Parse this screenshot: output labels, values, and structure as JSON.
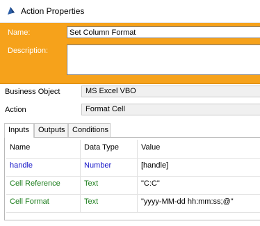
{
  "window": {
    "title": "Action Properties"
  },
  "header": {
    "name_label": "Name:",
    "name_value": "Set Column Format",
    "description_label": "Description:",
    "description_value": ""
  },
  "fields": {
    "business_object_label": "Business Object",
    "business_object_value": "MS Excel VBO",
    "action_label": "Action",
    "action_value": "Format Cell"
  },
  "tabs": [
    {
      "label": "Inputs",
      "active": true
    },
    {
      "label": "Outputs",
      "active": false
    },
    {
      "label": "Conditions",
      "active": false
    }
  ],
  "table": {
    "columns": [
      "Name",
      "Data Type",
      "Value"
    ],
    "rows": [
      {
        "name": "handle",
        "type": "Number",
        "value": "[handle]",
        "color": "#1414c8"
      },
      {
        "name": "Cell Reference",
        "type": "Text",
        "value": "\"C:C\"",
        "color": "#1a7d1a"
      },
      {
        "name": "Cell Format",
        "type": "Text",
        "value": "\"yyyy-MM-dd hh:mm:ss;@\"",
        "color": "#1a7d1a"
      }
    ]
  },
  "colors": {
    "header_bg": "#f6a21b",
    "number_text": "#1414c8",
    "text_type": "#1a7d1a"
  },
  "icons": {
    "app": "blueprism-icon"
  }
}
